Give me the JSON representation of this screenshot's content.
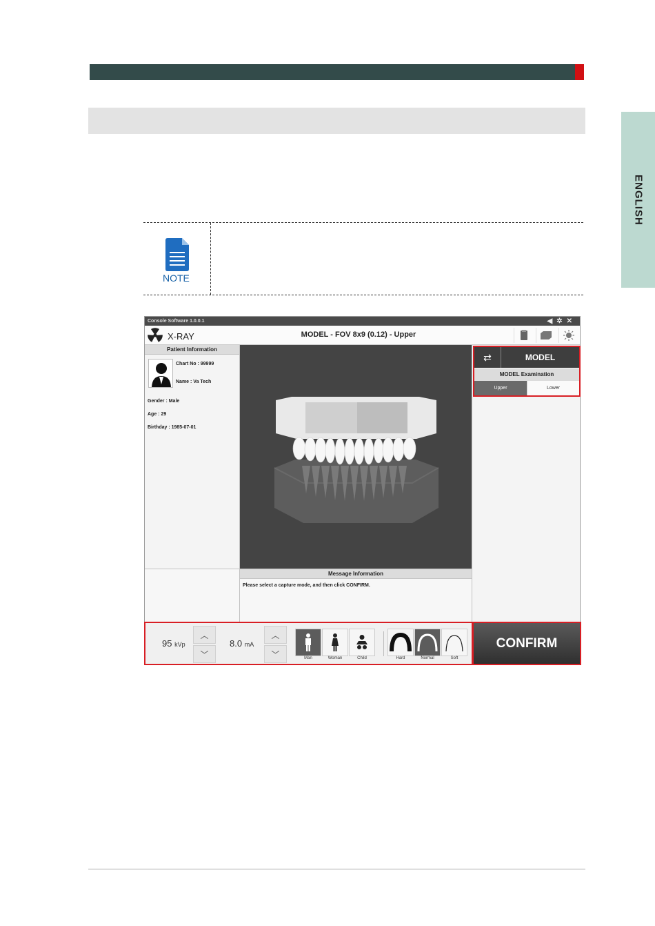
{
  "sidebar": {
    "language_tab": "ENGLISH"
  },
  "note": {
    "label": "NOTE"
  },
  "app": {
    "window_title": "Console Software  1.0.0.1",
    "header": {
      "app_label": "X-RAY",
      "mode_title": "MODEL - FOV 8x9 (0.12) - Upper"
    },
    "patient": {
      "heading": "Patient Information",
      "chart_no": "Chart No : 99999",
      "name": "Name : Va Tech",
      "gender": "Gender : Male",
      "age": "Age : 29",
      "birthday": "Birthday : 1985-07-01"
    },
    "model_panel": {
      "mode_name": "MODEL",
      "exam_label": "MODEL Examination",
      "options": [
        "Upper",
        "Lower"
      ],
      "selected": "Upper"
    },
    "message": {
      "heading": "Message Information",
      "text": "Please select a capture mode, and then click CONFIRM."
    },
    "exposure": {
      "kvp_value": "95",
      "kvp_unit": "kVp",
      "ma_value": "8.0",
      "ma_unit": "mA"
    },
    "patient_types": [
      "Man",
      "Woman",
      "Child"
    ],
    "patient_type_selected": "Man",
    "arch_types": [
      "Hard",
      "Normal",
      "Soft"
    ],
    "arch_type_selected": "Normal",
    "confirm_label": "CONFIRM"
  },
  "colors": {
    "header_bar": "#334b4a",
    "header_accent": "#d10f13",
    "language_tab": "#bcd9d0",
    "highlight_border": "#d81e24",
    "note_blue": "#1862a8"
  }
}
